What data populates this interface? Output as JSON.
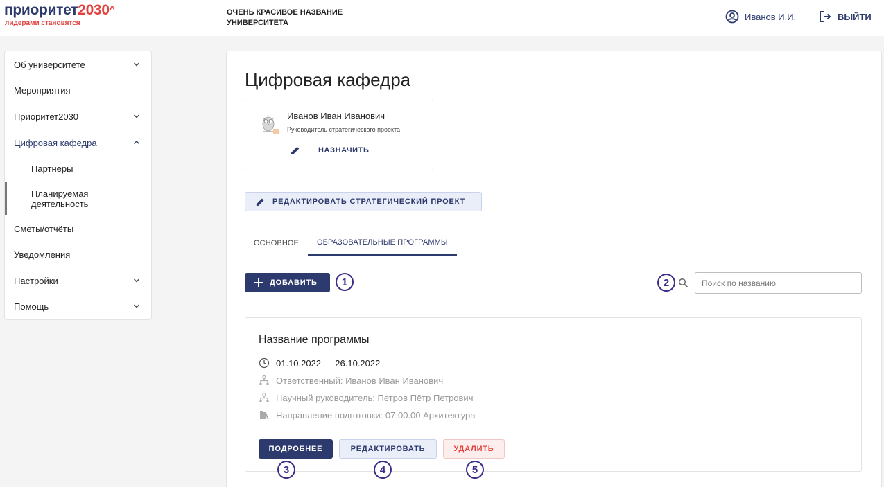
{
  "header": {
    "logo_main": "приоритет",
    "logo_num": "2030",
    "logo_caret": "^",
    "logo_sub": "лидерами становятся",
    "university_line1": "ОЧЕНЬ КРАСИВОЕ НАЗВАНИЕ",
    "university_line2": "УНИВЕРСИТЕТА",
    "user_name": "Иванов И.И.",
    "logout_label": "ВЫЙТИ",
    "user_icon": "user-circle-icon",
    "logout_icon": "logout-icon"
  },
  "sidebar": {
    "items": [
      {
        "label": "Об университете",
        "expandable": true,
        "expanded": false
      },
      {
        "label": "Мероприятия",
        "expandable": false
      },
      {
        "label": "Приоритет2030",
        "expandable": true,
        "expanded": false
      },
      {
        "label": "Цифровая кафедра",
        "expandable": true,
        "expanded": true,
        "active": true
      },
      {
        "label": "Сметы/отчёты",
        "expandable": false
      },
      {
        "label": "Уведомления",
        "expandable": false
      },
      {
        "label": "Настройки",
        "expandable": true,
        "expanded": false
      },
      {
        "label": "Помощь",
        "expandable": true,
        "expanded": false
      }
    ],
    "subitems": [
      {
        "label": "Партнеры"
      },
      {
        "label": "Планируемая деятельность",
        "current": true
      }
    ]
  },
  "main": {
    "title": "Цифровая кафедра",
    "person": {
      "name": "Иванов Иван Иванович",
      "role": "Руководитель стратегического проекта",
      "assign_label": "НАЗНАЧИТЬ"
    },
    "edit_strategy_label": "РЕДАКТИРОВАТЬ СТРАТЕГИЧЕСКИЙ ПРОЕКТ",
    "tabs": [
      {
        "label": "ОСНОВНОЕ",
        "selected": false
      },
      {
        "label": "ОБРАЗОВАТЕЛЬНЫЕ ПРОГРАММЫ",
        "selected": true
      }
    ],
    "add_label": "ДОБАВИТЬ",
    "search": {
      "placeholder": "Поиск по названию",
      "value": ""
    },
    "program": {
      "title": "Название программы",
      "dates": "01.10.2022 — 26.10.2022",
      "responsible": "Ответственный: Иванов Иван Иванович",
      "supervisor": "Научный руководитель: Петров Пётр Петрович",
      "direction": "Направление подготовки: 07.00.00 Архитектура",
      "details_label": "ПОДРОБНЕЕ",
      "edit_label": "РЕДАКТИРОВАТЬ",
      "delete_label": "УДАЛИТЬ"
    },
    "markers": [
      "1",
      "2",
      "3",
      "4",
      "5"
    ]
  },
  "colors": {
    "primary": "#2d3a6e",
    "accent_red": "#e3413e",
    "marker": "#3a2f88",
    "background": "#f4f4f4",
    "secondary_button_bg": "#eaeef8",
    "danger_button_bg": "#fdeeee"
  }
}
